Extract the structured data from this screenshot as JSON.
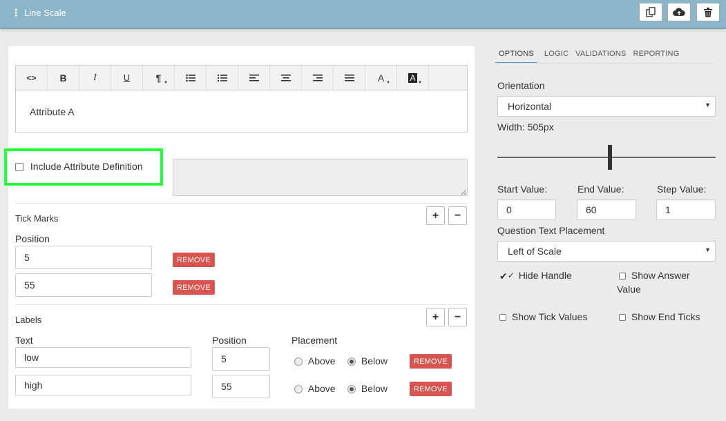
{
  "app": {
    "title": "Line Scale",
    "grip_icon": "drag-handle-icon"
  },
  "topbar_actions": [
    {
      "name": "duplicate-icon"
    },
    {
      "name": "cloud-upload-icon"
    },
    {
      "name": "trash-icon"
    }
  ],
  "editor": {
    "toolbar": [
      {
        "name": "code-view-icon",
        "glyph": "<>"
      },
      {
        "name": "bold-icon",
        "glyph": "B"
      },
      {
        "name": "italic-icon",
        "glyph": "I"
      },
      {
        "name": "underline-icon",
        "glyph": "U"
      },
      {
        "name": "paragraph-icon",
        "glyph": "¶"
      },
      {
        "name": "unordered-list-icon",
        "glyph": "≔"
      },
      {
        "name": "ordered-list-icon",
        "glyph": "≔"
      },
      {
        "name": "align-left-icon",
        "glyph": "≡"
      },
      {
        "name": "align-center-icon",
        "glyph": "≡"
      },
      {
        "name": "align-right-icon",
        "glyph": "≡"
      },
      {
        "name": "justify-icon",
        "glyph": "≡"
      },
      {
        "name": "font-color-icon",
        "glyph": "A"
      },
      {
        "name": "background-color-icon",
        "glyph": "A"
      }
    ],
    "content": "Attribute A"
  },
  "include_def": {
    "label": "Include Attribute Definition",
    "checked": false
  },
  "tick_marks": {
    "title": "Tick Marks",
    "position_label": "Position",
    "items": [
      {
        "value": "5"
      },
      {
        "value": "55"
      }
    ],
    "remove_label": "REMOVE",
    "add_label": "+",
    "minus_label": "−"
  },
  "labels_section": {
    "title": "Labels",
    "text_header": "Text",
    "position_header": "Position",
    "placement_header": "Placement",
    "above_label": "Above",
    "below_label": "Below",
    "remove_label": "REMOVE",
    "add_label": "+",
    "minus_label": "−",
    "rows": [
      {
        "text": "low",
        "position": "5",
        "placement": "Below"
      },
      {
        "text": "high",
        "position": "55",
        "placement": "Below"
      }
    ]
  },
  "right": {
    "tabs": [
      "OPTIONS",
      "LOGIC",
      "VALIDATIONS",
      "REPORTING"
    ],
    "active_tab": "OPTIONS",
    "orientation_label": "Orientation",
    "orientation_value": "Horizontal",
    "width_label": "Width: 505px",
    "start_label": "Start Value:",
    "start_value": "0",
    "end_label": "End Value:",
    "end_value": "60",
    "step_label": "Step Value:",
    "step_value": "1",
    "qtp_label": "Question Text Placement",
    "qtp_value": "Left of Scale",
    "hide_handle_label": "Hide Handle",
    "show_answer_label_1": "Show Answer",
    "show_answer_label_2": "Value",
    "show_tick_values_label": "Show Tick Values",
    "show_end_ticks_label": "Show End Ticks",
    "accent": "#5a9ec2"
  },
  "colors": {
    "topbar": "#8bb5c9",
    "remove": "#d9534f",
    "highlight": "#22ff3a"
  }
}
